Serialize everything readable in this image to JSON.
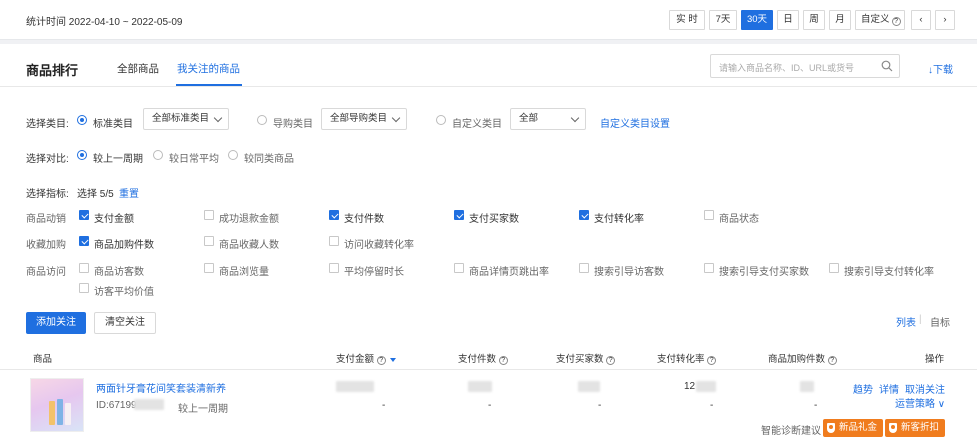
{
  "topbar": {
    "stat_time": "统计时间 2022-04-10 ~ 2022-05-09",
    "ranges": [
      "实 时",
      "7天",
      "30天",
      "日",
      "周",
      "月",
      "自定义"
    ],
    "active_range": "30天",
    "prev": "‹",
    "next": "›"
  },
  "header": {
    "title": "商品排行",
    "tabs": [
      "全部商品",
      "我关注的商品"
    ],
    "active_tab": "我关注的商品",
    "search_placeholder": "请输入商品名称、ID、URL或货号",
    "download": "↓下载"
  },
  "category": {
    "label": "选择类目:",
    "options": [
      {
        "label": "标准类目",
        "selected": true,
        "dropdown": "全部标准类目"
      },
      {
        "label": "导购类目",
        "selected": false,
        "dropdown": "全部导购类目"
      },
      {
        "label": "自定义类目",
        "selected": false,
        "dropdown": "全部"
      }
    ],
    "settings_link": "自定义类目设置"
  },
  "compare": {
    "label": "选择对比:",
    "options": [
      {
        "label": "较上一周期",
        "selected": true
      },
      {
        "label": "较日常平均",
        "selected": false
      },
      {
        "label": "较同类商品",
        "selected": false
      }
    ]
  },
  "metrics": {
    "label": "选择指标:",
    "count": "选择 5/5",
    "reset": "重置",
    "groups": [
      {
        "name": "商品动销",
        "items": [
          {
            "label": "支付金额",
            "checked": true
          },
          {
            "label": "成功退款金额",
            "checked": false
          },
          {
            "label": "支付件数",
            "checked": true
          },
          {
            "label": "支付买家数",
            "checked": true
          },
          {
            "label": "支付转化率",
            "checked": true
          },
          {
            "label": "商品状态",
            "checked": false
          }
        ]
      },
      {
        "name": "收藏加购",
        "items": [
          {
            "label": "商品加购件数",
            "checked": true
          },
          {
            "label": "商品收藏人数",
            "checked": false
          },
          {
            "label": "访问收藏转化率",
            "checked": false
          }
        ]
      },
      {
        "name": "商品访问",
        "items": [
          {
            "label": "商品访客数",
            "checked": false
          },
          {
            "label": "商品浏览量",
            "checked": false
          },
          {
            "label": "平均停留时长",
            "checked": false
          },
          {
            "label": "商品详情页跳出率",
            "checked": false
          },
          {
            "label": "搜索引导访客数",
            "checked": false
          },
          {
            "label": "搜索引导支付买家数",
            "checked": false
          },
          {
            "label": "搜索引导支付转化率",
            "checked": false
          },
          {
            "label": "访客平均价值",
            "checked": false
          }
        ]
      }
    ]
  },
  "actions": {
    "add_follow": "添加关注",
    "clear_follow": "清空关注",
    "view_list": "列表",
    "view_sep": "|",
    "view_metric": "自标"
  },
  "table": {
    "headers": [
      "商品",
      "支付金额",
      "支付件数",
      "支付买家数",
      "支付转化率",
      "商品加购件数",
      "操作"
    ],
    "row": {
      "name": "两面针牙膏花间笑套装清新养",
      "id_prefix": "ID:67199",
      "compare": "较上一周期",
      "dash": "-",
      "rate_prefix": "12",
      "ops": [
        "趋势",
        "详情",
        "取消关注"
      ],
      "strategy": "运营策略 ∨",
      "diagnose": "智能诊断建议",
      "badges": [
        "新品礼金",
        "新客折扣"
      ]
    }
  },
  "colors": {
    "accent": "#1f6fe0",
    "orange": "#f07c1e"
  }
}
